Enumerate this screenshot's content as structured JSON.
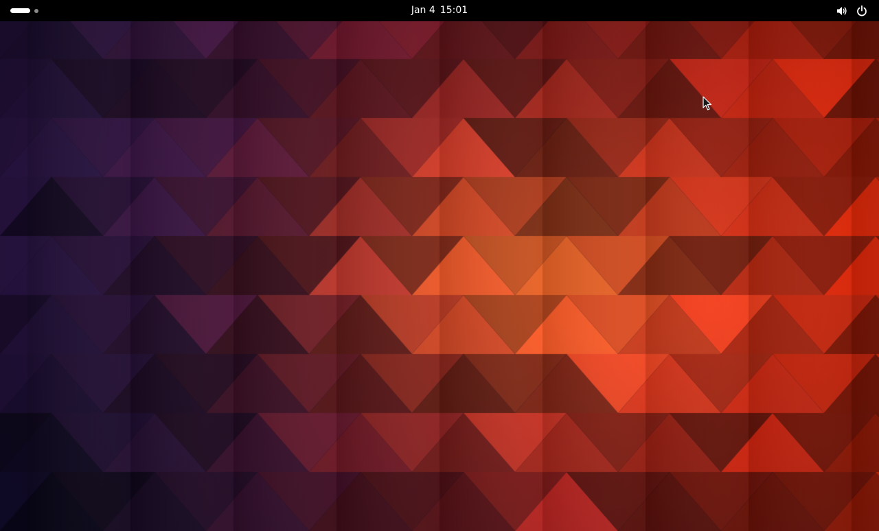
{
  "top_bar": {
    "date": "Jan 4",
    "time": "15:01",
    "background": "#000000",
    "text_color": "#ffffff"
  },
  "activities": {
    "indicator": "workspace-indicator",
    "workspaces": 2,
    "active_workspace": 1
  },
  "status_icons": [
    "volume-icon",
    "power-icon"
  ],
  "wallpaper": {
    "style": "geometric triangles",
    "colors": [
      "#0a0a22",
      "#241a55",
      "#5a1438",
      "#8c1a24",
      "#c8321a",
      "#f07a2a"
    ]
  }
}
